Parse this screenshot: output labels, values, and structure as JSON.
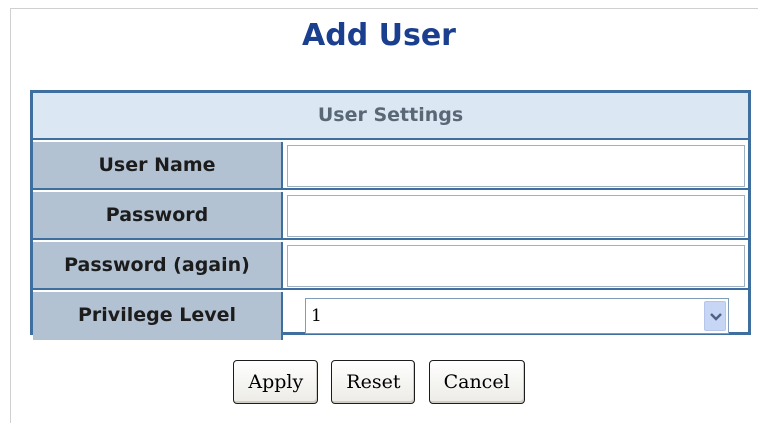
{
  "page": {
    "title": "Add User"
  },
  "settings": {
    "header": "User Settings",
    "rows": [
      {
        "label": "User Name",
        "value": ""
      },
      {
        "label": "Password",
        "value": ""
      },
      {
        "label": "Password (again)",
        "value": ""
      },
      {
        "label": "Privilege Level",
        "value": "1"
      }
    ]
  },
  "buttons": {
    "apply": "Apply",
    "reset": "Reset",
    "cancel": "Cancel"
  },
  "colors": {
    "title": "#1b3f8f",
    "border": "#3f6f9e",
    "header_bg": "#dbe7f3",
    "label_bg": "#b2c2d2"
  },
  "icons": {
    "dropdown": "chevron-down-icon"
  }
}
